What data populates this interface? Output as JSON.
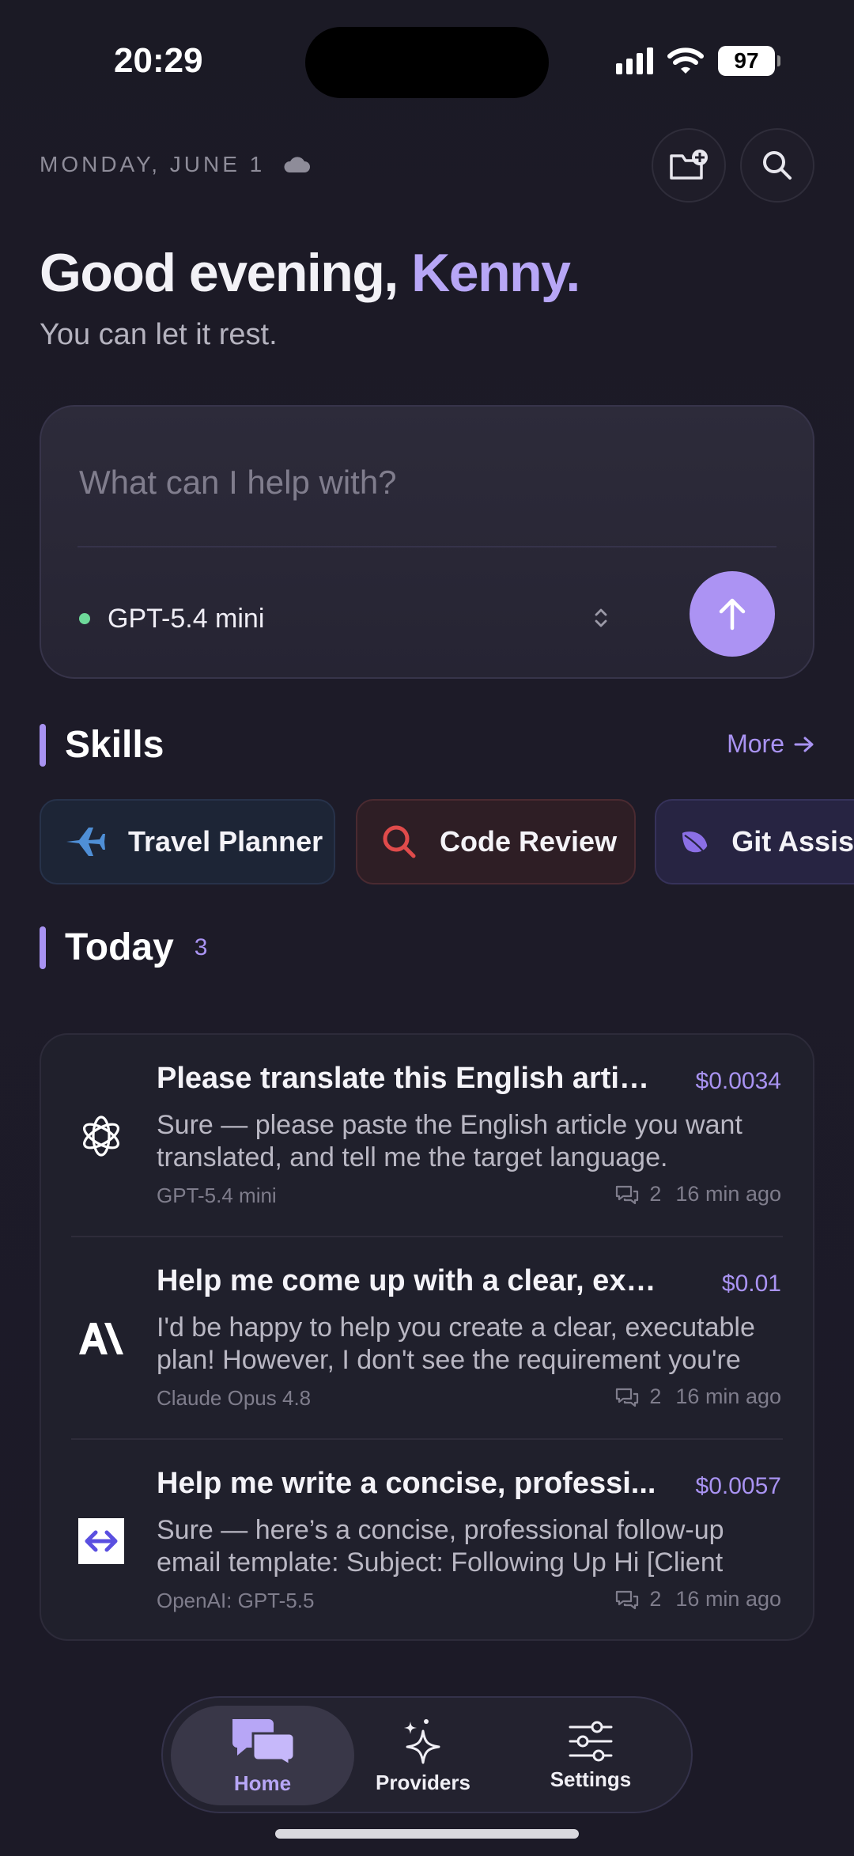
{
  "status_bar": {
    "time": "20:29",
    "battery": "97"
  },
  "header": {
    "date": "MONDAY, JUNE 1",
    "greeting_prefix": "Good evening, ",
    "greeting_name": "Kenny.",
    "subtitle": "You can let it rest."
  },
  "composer": {
    "placeholder": "What can I help with?",
    "model": "GPT-5.4 mini"
  },
  "skills": {
    "title": "Skills",
    "more": "More",
    "items": [
      {
        "label": "Travel Planner",
        "icon": "airplane-icon"
      },
      {
        "label": "Code Review",
        "icon": "search-icon"
      },
      {
        "label": "Git Assistant",
        "icon": "leaf-icon"
      }
    ]
  },
  "today": {
    "title": "Today",
    "count": "3",
    "chats": [
      {
        "title": "Please translate this English articl...",
        "cost": "$0.0034",
        "preview": "Sure — please paste the English article you want translated, and tell me the target language.",
        "model": "GPT-5.4 mini",
        "messages": "2",
        "time": "16 min ago",
        "logo": "openai-logo-icon"
      },
      {
        "title": "Help me come up with a clear, exec...",
        "cost": "$0.01",
        "preview": "I'd be happy to help you create a clear, executable plan! However, I don't see the requirement you're",
        "model": "Claude Opus 4.8",
        "messages": "2",
        "time": "16 min ago",
        "logo": "anthropic-logo-icon"
      },
      {
        "title": "Help me write a concise, professi...",
        "cost": "$0.0057",
        "preview": "Sure — here’s a concise, professional follow-up email template: Subject: Following Up Hi [Client",
        "model": "OpenAI: GPT-5.5",
        "messages": "2",
        "time": "16 min ago",
        "logo": "openrouter-logo-icon"
      }
    ]
  },
  "tabs": [
    {
      "label": "Home",
      "icon": "chat-bubbles-icon",
      "active": true
    },
    {
      "label": "Providers",
      "icon": "sparkles-icon",
      "active": false
    },
    {
      "label": "Settings",
      "icon": "sliders-icon",
      "active": false
    }
  ],
  "colors": {
    "background": "#1c1a26",
    "accent": "#a993f2",
    "online_dot": "#6ed99a"
  }
}
